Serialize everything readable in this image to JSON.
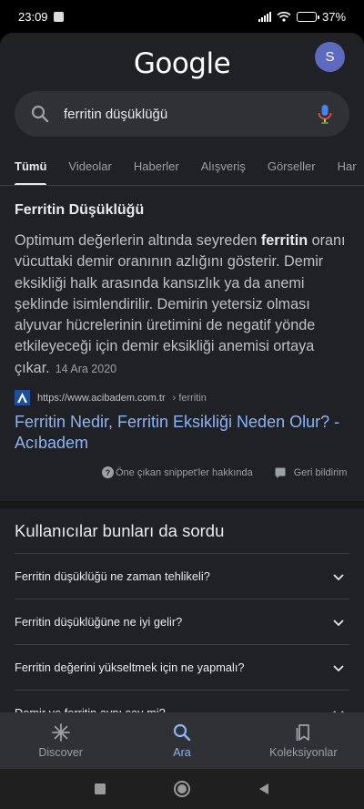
{
  "status": {
    "time": "23:09",
    "battery": "37",
    "battery_level": 0.37
  },
  "app": {
    "logo": "Google",
    "avatar_letter": "S"
  },
  "search": {
    "query": "ferritin düşüklüğü"
  },
  "tabs": [
    "Tümü",
    "Videolar",
    "Haberler",
    "Alışveriş",
    "Görseller",
    "Har"
  ],
  "snippet": {
    "title": "Ferritin Düşüklüğü",
    "text_pre": "Optimum değerlerin altında seyreden ",
    "text_bold": "ferritin",
    "text_post": " oranı vücuttaki demir oranının azlığını gösterir. Demir eksikliği halk arasında kansızlık ya da anemi şeklinde isimlendirilir. Demirin yetersiz olması alyuvar hücrelerinin üretimini de negatif yönde etkileyeceği için demir eksikliği anemisi ortaya çıkar.",
    "date": "14 Ara 2020",
    "source_url": "https://www.acibadem.com.tr",
    "source_path": "› ferritin",
    "link_title": "Ferritin Nedir, Ferritin Eksikliği Neden Olur? - Acıbadem",
    "about_label": "Öne çıkan snippet'ler hakkında",
    "feedback_label": "Geri bildirim"
  },
  "paa": {
    "title": "Kullanıcılar bunları da sordu",
    "items": [
      "Ferritin düşüklüğü ne zaman tehlikeli?",
      "Ferritin düşüklüğüne ne iyi gelir?",
      "Ferritin değerini yükseltmek için ne yapmalı?",
      "Demir ve ferritin aynı şey mi?"
    ]
  },
  "bottom_nav": {
    "discover": "Discover",
    "search": "Ara",
    "collections": "Koleksiyonlar"
  },
  "colors": {
    "background": "#202124",
    "link": "#8ab4f8",
    "avatar": "#5c6bc0"
  }
}
